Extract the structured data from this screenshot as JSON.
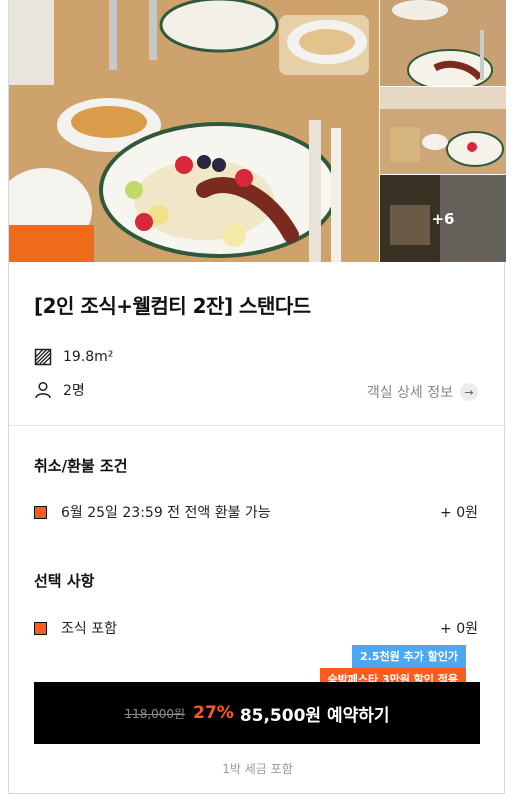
{
  "gallery": {
    "more_label": "+6"
  },
  "room": {
    "title": "[2인 조식+웰컴티 2잔] 스탠다드",
    "area": "19.8m²",
    "capacity": "2명",
    "detail_link": "객실 상세 정보"
  },
  "refund": {
    "heading": "취소/환불 조건",
    "option_text": "6월 25일 23:59 전 전액 환불 가능",
    "option_price": "+ 0원"
  },
  "options": {
    "heading": "선택 사항",
    "option_text": "조식 포함",
    "option_price": "+ 0원"
  },
  "promo": {
    "blue_badge": "2.5천원 추가 할인가",
    "orange_badge": "숙박페스타 3만원 할인 적용"
  },
  "booking": {
    "original_price": "118,000원",
    "discount": "27%",
    "final_label": "85,500원 예약하기",
    "tax_note": "1박 세금 포함"
  },
  "colors": {
    "accent": "#ff5a1f",
    "badge_blue": "#4ea7f2",
    "button_bg": "#000000"
  }
}
